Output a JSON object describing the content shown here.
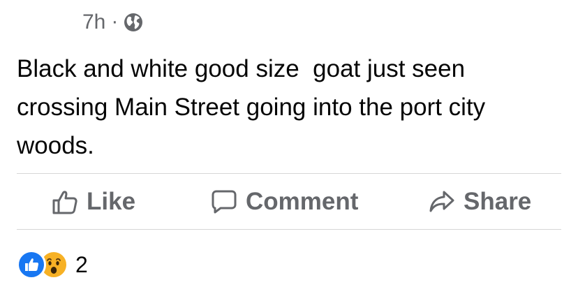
{
  "post": {
    "time": "7h",
    "separator": "·",
    "privacy_icon": "globe-icon",
    "text": "Black and white good size  goat just seen crossing Main Street going into the port city woods."
  },
  "actions": {
    "like_label": "Like",
    "comment_label": "Comment",
    "share_label": "Share"
  },
  "reactions": {
    "icons": [
      "like-reaction-icon",
      "wow-reaction-icon"
    ],
    "count": "2"
  },
  "colors": {
    "text": "#050505",
    "secondary": "#65676b",
    "like_blue": "#1877f2",
    "wow_yellow": "#f7b125",
    "divider": "#d6d6d6"
  }
}
